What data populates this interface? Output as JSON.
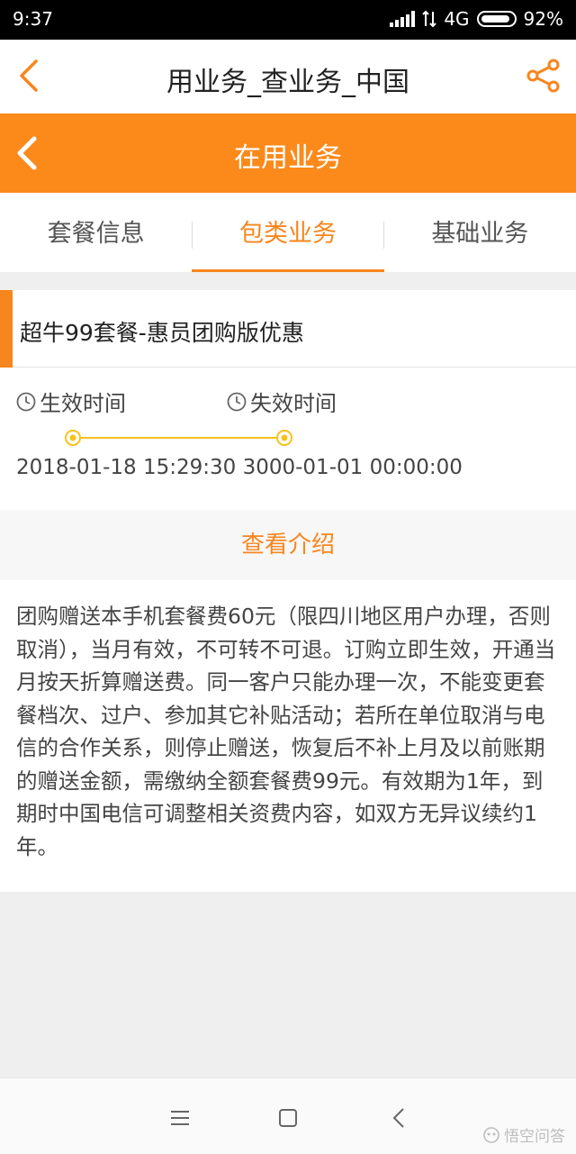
{
  "status_bar": {
    "time": "9:37",
    "network": "4G",
    "battery": "92%"
  },
  "topbar": {
    "title": "用业务_查业务_中国"
  },
  "header": {
    "title": "在用业务"
  },
  "tabs": [
    {
      "label": "套餐信息"
    },
    {
      "label": "包类业务"
    },
    {
      "label": "基础业务"
    }
  ],
  "package": {
    "name": "超牛99套餐-惠员团购版优惠",
    "effective_label": "生效时间",
    "expire_label": "失效时间",
    "effective_value": "2018-01-18 15:29:30",
    "expire_value": "3000-01-01 00:00:00",
    "intro_button": "查看介绍",
    "description": "团购赠送本手机套餐费60元（限四川地区用户办理，否则取消），当月有效，不可转不可退。订购立即生效，开通当月按天折算赠送费。同一客户只能办理一次，不能变更套餐档次、过户、参加其它补贴活动；若所在单位取消与电信的合作关系，则停止赠送，恢复后不补上月及以前账期的赠送金额，需缴纳全额套餐费99元。有效期为1年，到期时中国电信可调整相关资费内容，如双方无异议续约1年。"
  },
  "watermark": "悟空问答",
  "colors": {
    "accent": "#fb8a1b",
    "timeline": "#f6c21a"
  }
}
